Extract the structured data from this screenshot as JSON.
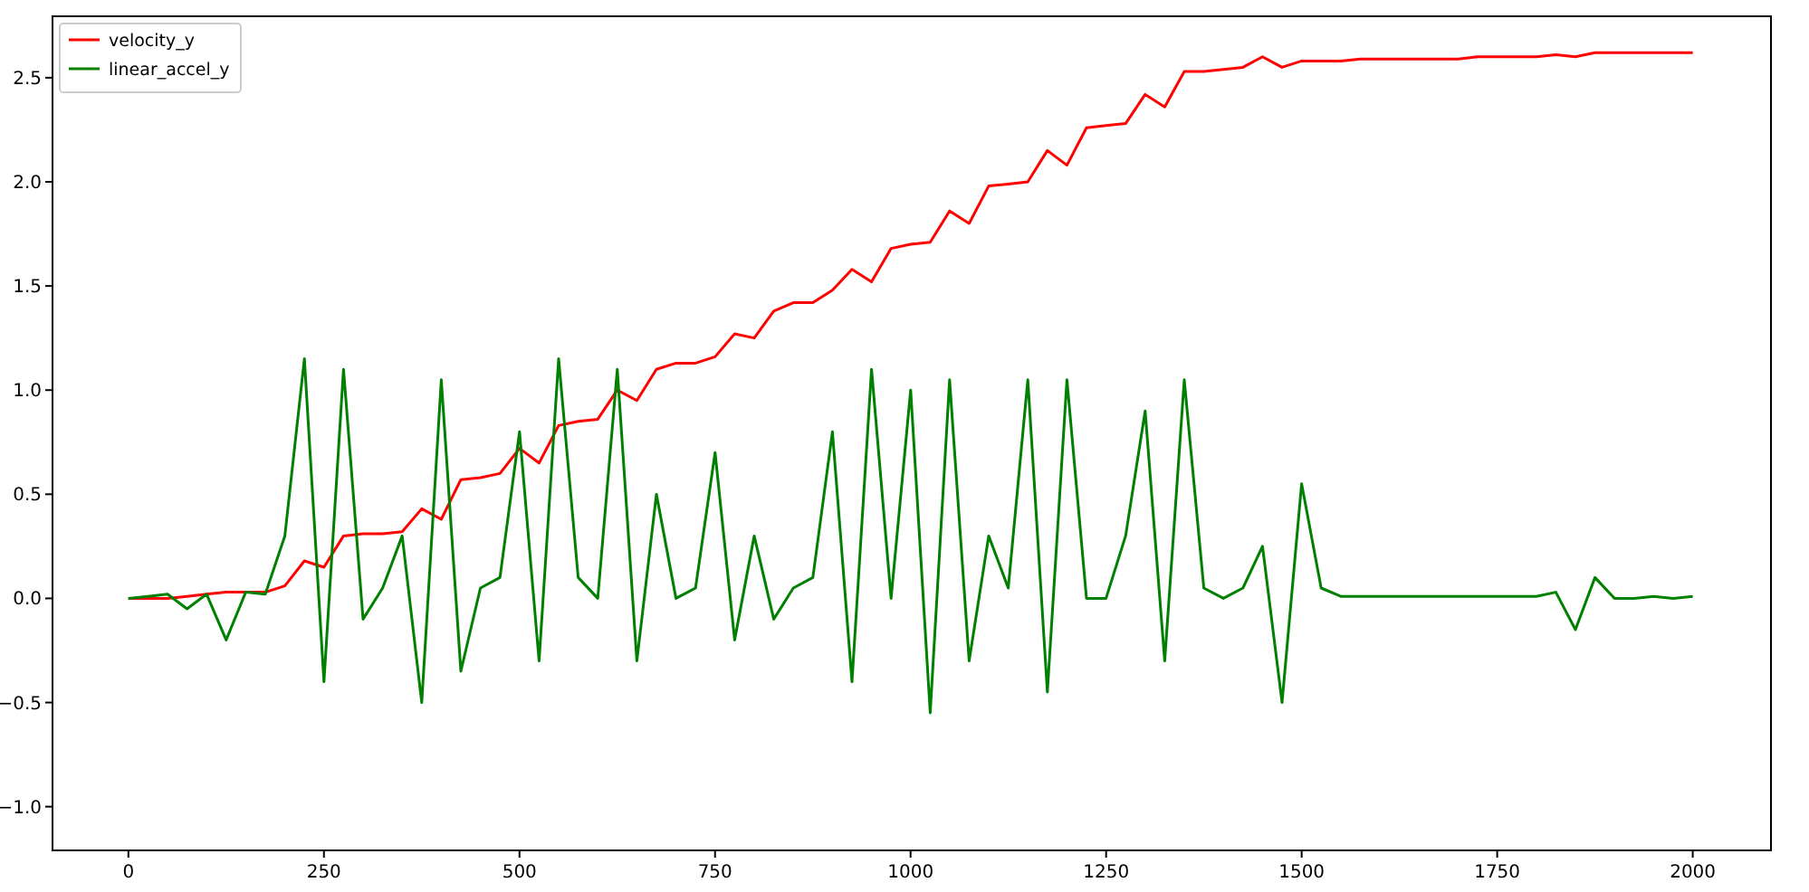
{
  "chart_data": {
    "type": "line",
    "legend": true,
    "xlim": [
      -97,
      2100
    ],
    "ylim": [
      -1.21,
      2.795
    ],
    "xticks": [
      0,
      250,
      500,
      750,
      1000,
      1250,
      1500,
      1750,
      2000
    ],
    "yticks": [
      {
        "value": -1,
        "label": "−1.0"
      },
      {
        "value": -0.5,
        "label": "−0.5"
      },
      {
        "value": 0,
        "label": "0.0"
      },
      {
        "value": 0.5,
        "label": "0.5"
      },
      {
        "value": 1,
        "label": "1.0"
      },
      {
        "value": 1.5,
        "label": "1.5"
      },
      {
        "value": 2,
        "label": "2.0"
      },
      {
        "value": 2.5,
        "label": "2.5"
      }
    ],
    "x": [
      0,
      25,
      50,
      75,
      100,
      125,
      150,
      175,
      200,
      225,
      250,
      275,
      300,
      325,
      350,
      375,
      400,
      425,
      450,
      475,
      500,
      525,
      550,
      575,
      600,
      625,
      650,
      675,
      700,
      725,
      750,
      775,
      800,
      825,
      850,
      875,
      900,
      925,
      950,
      975,
      1000,
      1025,
      1050,
      1075,
      1100,
      1125,
      1150,
      1175,
      1200,
      1225,
      1250,
      1275,
      1300,
      1325,
      1350,
      1375,
      1400,
      1425,
      1450,
      1475,
      1500,
      1525,
      1550,
      1575,
      1600,
      1625,
      1650,
      1675,
      1700,
      1725,
      1750,
      1775,
      1800,
      1825,
      1850,
      1875,
      1900,
      1925,
      1950,
      1975,
      2000
    ],
    "series": [
      {
        "name": "velocity_y",
        "color": "#ff0000",
        "values": [
          0,
          0,
          0,
          0.01,
          0.02,
          0.03,
          0.03,
          0.03,
          0.06,
          0.18,
          0.15,
          0.3,
          0.31,
          0.31,
          0.32,
          0.43,
          0.38,
          0.57,
          0.58,
          0.6,
          0.72,
          0.65,
          0.83,
          0.85,
          0.86,
          1.0,
          0.95,
          1.1,
          1.13,
          1.13,
          1.16,
          1.27,
          1.25,
          1.38,
          1.42,
          1.42,
          1.48,
          1.58,
          1.52,
          1.68,
          1.7,
          1.71,
          1.86,
          1.8,
          1.98,
          1.99,
          2.0,
          2.15,
          2.08,
          2.26,
          2.27,
          2.28,
          2.42,
          2.36,
          2.53,
          2.53,
          2.54,
          2.55,
          2.6,
          2.55,
          2.58,
          2.58,
          2.58,
          2.59,
          2.59,
          2.59,
          2.59,
          2.59,
          2.59,
          2.6,
          2.6,
          2.6,
          2.6,
          2.61,
          2.6,
          2.62,
          2.62,
          2.62,
          2.62,
          2.62,
          2.62
        ]
      },
      {
        "name": "linear_accel_y",
        "color": "#008000",
        "values": [
          0,
          0.01,
          0.02,
          -0.05,
          0.02,
          -0.2,
          0.03,
          0.02,
          0.3,
          1.15,
          -0.4,
          1.1,
          -0.1,
          0.05,
          0.3,
          -0.5,
          1.05,
          -0.35,
          0.05,
          0.1,
          0.8,
          -0.3,
          1.15,
          0.1,
          0,
          1.1,
          -0.3,
          0.5,
          0,
          0.05,
          0.7,
          -0.2,
          0.3,
          -0.1,
          0.05,
          0.1,
          0.8,
          -0.4,
          1.1,
          0,
          1.0,
          -0.55,
          1.05,
          -0.3,
          0.3,
          0.05,
          1.05,
          -0.45,
          1.05,
          0,
          0,
          0.3,
          0.9,
          -0.3,
          1.05,
          0.05,
          0,
          0.05,
          0.25,
          -0.5,
          0.55,
          0.05,
          0.01,
          0.01,
          0.01,
          0.01,
          0.01,
          0.01,
          0.01,
          0.01,
          0.01,
          0.01,
          0.01,
          0.03,
          -0.15,
          0.1,
          0,
          0,
          0.01,
          0,
          0.01
        ]
      }
    ]
  }
}
